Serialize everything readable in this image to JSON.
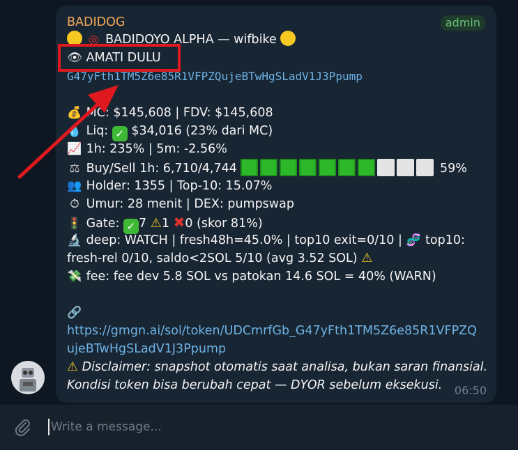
{
  "message": {
    "sender": "BADIDOG",
    "badge": "admin",
    "title_line": "BADIDOYO ALPHA — wifbike",
    "status_text": "AMATI DULU",
    "contract": "G47yFth1TM5Z6e85R1VFPZQujeBTwHgSLadV1J3Ppump",
    "mc_line": "MC: $145,608 | FDV: $145,608",
    "liq_label": "Liq:",
    "liq_value": "$34,016 (23% dari MC)",
    "change_line": "1h: 235% | 5m: -2.56%",
    "buysell_label": "Buy/Sell 1h: 6,710/4,744",
    "buy_ratio_pct": 59,
    "buy_ratio_text": "59%",
    "holder_line": "Holder: 1355 | Top-10: 15.07%",
    "age_line": "Umur: 28 menit | DEX: pumpswap",
    "gate_label": "Gate:",
    "gate_pass": "7",
    "gate_warn": "1",
    "gate_fail": "0 (skor 81%)",
    "deep_line": "deep: WATCH | fresh48h=45.0% | top10 exit=0/10 |",
    "deep_tail": "top10:",
    "deep_line2": "fresh-rel 0/10, saldo<2SOL 5/10 (avg 3.52 SOL)",
    "fee_line": "fee: fee dev 5.8 SOL vs patokan 14.6 SOL = 40% (WARN)",
    "url_line1": "https://gmgn.ai/sol/token/UDCmrfGb_G47yFth1TM5Z6e85R1VFPZQ",
    "url_line2": "ujeBTwHgSLadV1J3Ppump",
    "disclaimer1": "Disclaimer: snapshot otomatis saat analisa, bukan saran finansial.",
    "disclaimer2": "Kondisi token bisa berubah cepat — DYOR sebelum eksekusi.",
    "time": "06:50"
  },
  "composer": {
    "placeholder": "Write a message..."
  },
  "icons": {
    "title_left": "yellow-circle-icon",
    "title_dart": "dart-icon",
    "title_right": "yellow-circle-icon",
    "eye": "eye-icon",
    "mc": "money-bag-icon",
    "liq": "droplet-icon",
    "change": "chart-up-icon",
    "buysell": "scales-icon",
    "holder": "people-icon",
    "age": "stopwatch-icon",
    "gate": "traffic-light-icon",
    "deep": "microscope-icon",
    "dna": "dna-icon",
    "fee": "money-wings-icon",
    "link": "link-icon",
    "attach": "paperclip-icon"
  },
  "colors": {
    "sender": "#f5a857",
    "link": "#6fb3e6",
    "highlight": "#e0191e",
    "bar_green": "#2db82a",
    "bar_empty": "#e4e4e4"
  }
}
